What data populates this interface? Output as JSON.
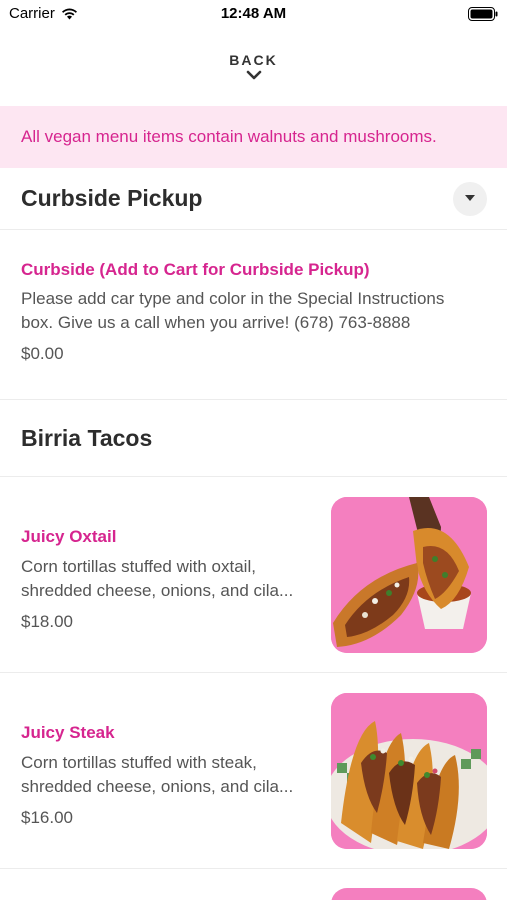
{
  "status_bar": {
    "carrier": "Carrier",
    "time": "12:48 AM"
  },
  "nav": {
    "back_label": "BACK"
  },
  "notice": "All vegan menu items contain walnuts and mushrooms.",
  "section": {
    "title": "Curbside Pickup"
  },
  "curbside_item": {
    "name": "Curbside (Add to Cart for Curbside Pickup)",
    "desc_line1": "Please add car type and color in the Special Instructions",
    "desc_line2": "box. Give us a call when you arrive! (678) 763-8888",
    "price": "$0.00"
  },
  "category": {
    "title": "Birria Tacos"
  },
  "items": [
    {
      "name": "Juicy Oxtail",
      "desc_line1": "Corn tortillas stuffed with oxtail,",
      "desc_line2": "shredded cheese, onions, and cila...",
      "price": "$18.00"
    },
    {
      "name": "Juicy Steak",
      "desc_line1": "Corn tortillas stuffed with steak,",
      "desc_line2": "shredded cheese, onions, and cila...",
      "price": "$16.00"
    }
  ],
  "colors": {
    "accent": "#d6258f",
    "notice_bg": "#fde6f2",
    "thumb_bg": "#f47fbf"
  }
}
